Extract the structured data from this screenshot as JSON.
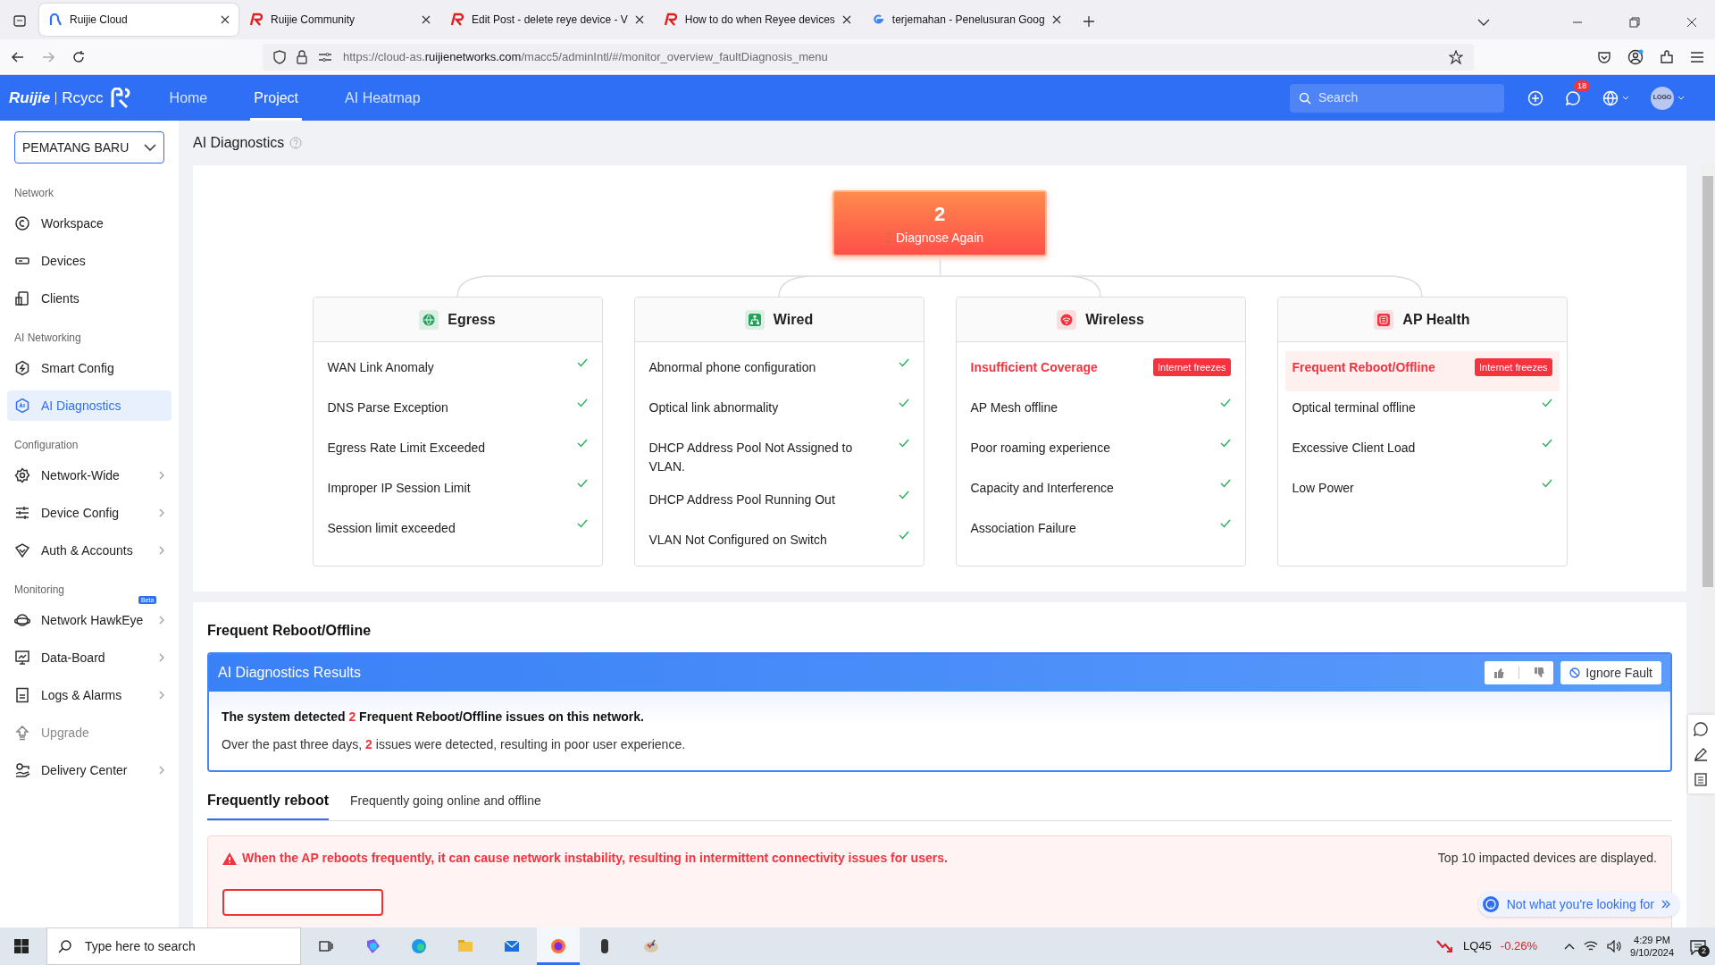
{
  "browser": {
    "tabs": [
      {
        "kind": "cloud",
        "title": "Ruijie Cloud",
        "selected": true
      },
      {
        "kind": "ruijie",
        "title": "Ruijie Community",
        "selected": false
      },
      {
        "kind": "ruijie",
        "title": "Edit Post - delete reye device - V",
        "selected": false
      },
      {
        "kind": "ruijie",
        "title": "How to do when Reyee devices",
        "selected": false
      },
      {
        "kind": "google",
        "title": "terjemahan - Penelusuran Goog",
        "selected": false
      }
    ],
    "url": {
      "prefix": "https://cloud-as.",
      "domain": "ruijienetworks.com",
      "path": "/macc5/adminIntl/#/monitor_overview_faultDiagnosis_menu"
    }
  },
  "header": {
    "logo": {
      "brand": "Ruijie",
      "product": "Rcycc"
    },
    "nav": [
      {
        "label": "Home",
        "selected": false
      },
      {
        "label": "Project",
        "selected": true
      },
      {
        "label": "AI Heatmap",
        "selected": false
      }
    ],
    "search": {
      "placeholder": "Search"
    },
    "notifications": "18",
    "avatar": "LOGO"
  },
  "sidebar": {
    "project": "PEMATANG BARU",
    "sections": [
      {
        "title": "Network",
        "items": [
          {
            "label": "Workspace",
            "selected": false,
            "expandable": false,
            "disabled": false
          },
          {
            "label": "Devices",
            "selected": false,
            "expandable": false,
            "disabled": false
          },
          {
            "label": "Clients",
            "selected": false,
            "expandable": false,
            "disabled": false
          }
        ]
      },
      {
        "title": "AI Networking",
        "items": [
          {
            "label": "Smart Config",
            "selected": false,
            "expandable": false,
            "disabled": false
          },
          {
            "label": "AI Diagnostics",
            "selected": true,
            "expandable": false,
            "disabled": false
          }
        ]
      },
      {
        "title": "Configuration",
        "items": [
          {
            "label": "Network-Wide",
            "selected": false,
            "expandable": true,
            "disabled": false
          },
          {
            "label": "Device Config",
            "selected": false,
            "expandable": true,
            "disabled": false
          },
          {
            "label": "Auth & Accounts",
            "selected": false,
            "expandable": true,
            "disabled": false
          }
        ]
      },
      {
        "title": "Monitoring",
        "items": [
          {
            "label": "Network HawkEye",
            "badge": "Beta",
            "selected": false,
            "expandable": true,
            "disabled": false
          },
          {
            "label": "Data-Board",
            "selected": false,
            "expandable": true,
            "disabled": false
          },
          {
            "label": "Logs & Alarms",
            "selected": false,
            "expandable": true,
            "disabled": false
          },
          {
            "label": "Upgrade",
            "selected": false,
            "expandable": false,
            "disabled": true
          },
          {
            "label": "Delivery Center",
            "selected": false,
            "expandable": true,
            "disabled": false
          }
        ]
      }
    ]
  },
  "page_title": "AI Diagnostics",
  "diagnosis": {
    "count": "2",
    "action": "Diagnose Again",
    "categories": [
      {
        "title": "Egress",
        "color": "#22a35a",
        "items": [
          {
            "kind": "ok",
            "label": "WAN Link Anomaly",
            "selected": false
          },
          {
            "kind": "ok",
            "label": "DNS Parse Exception",
            "selected": false
          },
          {
            "kind": "ok",
            "label": "Egress Rate Limit Exceeded",
            "selected": false
          },
          {
            "kind": "ok",
            "label": "Improper IP Session Limit",
            "selected": false
          },
          {
            "kind": "ok",
            "label": "Session limit exceeded",
            "selected": false
          }
        ]
      },
      {
        "title": "Wired",
        "color": "#22a35a",
        "items": [
          {
            "kind": "ok",
            "label": "Abnormal phone configuration",
            "selected": false
          },
          {
            "kind": "ok",
            "label": "Optical link abnormality",
            "selected": false
          },
          {
            "kind": "ok",
            "label": "DHCP Address Pool Not Assigned to VLAN.",
            "selected": false
          },
          {
            "kind": "ok",
            "label": "DHCP Address Pool Running Out",
            "selected": false
          },
          {
            "kind": "ok",
            "label": "VLAN Not Configured on Switch",
            "selected": false
          }
        ]
      },
      {
        "title": "Wireless",
        "color": "#f5333f",
        "items": [
          {
            "kind": "fault",
            "label": "Insufficient Coverage",
            "tag": "Internet freezes",
            "selected": false
          },
          {
            "kind": "ok",
            "label": "AP Mesh offline",
            "selected": false
          },
          {
            "kind": "ok",
            "label": "Poor roaming experience",
            "selected": false
          },
          {
            "kind": "ok",
            "label": "Capacity and Interference",
            "selected": false
          },
          {
            "kind": "ok",
            "label": "Association Failure",
            "selected": false
          }
        ]
      },
      {
        "title": "AP Health",
        "color": "#f5333f",
        "items": [
          {
            "kind": "fault",
            "label": "Frequent Reboot/Offline",
            "tag": "Internet freezes",
            "selected": true
          },
          {
            "kind": "ok",
            "label": "Optical terminal offline",
            "selected": false
          },
          {
            "kind": "ok",
            "label": "Excessive Client Load",
            "selected": false
          },
          {
            "kind": "ok",
            "label": "Low Power",
            "selected": false
          }
        ]
      }
    ]
  },
  "detail": {
    "title": "Frequent Reboot/Offline",
    "results_title": "AI Diagnostics Results",
    "ignore_button": "Ignore Fault",
    "summary": {
      "before": "The system detected ",
      "count": "2",
      "after": " Frequent Reboot/Offline issues on this network."
    },
    "description": {
      "before": "Over the past three days, ",
      "count": "2",
      "after": " issues were detected, resulting in poor user experience."
    },
    "tabs": [
      {
        "label": "Frequently reboot",
        "selected": true
      },
      {
        "label": "Frequently going online and offline",
        "selected": false
      }
    ],
    "warning": "When the AP reboots frequently, it can cause network instability, resulting in intermittent connectivity issues for users.",
    "note": "Top 10 impacted devices are displayed."
  },
  "help_bubble": "Not what you're looking for",
  "taskbar": {
    "search": {
      "placeholder": "Type here to search"
    },
    "apps": [
      {
        "selected": false
      },
      {
        "selected": false
      },
      {
        "selected": false
      },
      {
        "selected": false
      },
      {
        "selected": true
      },
      {
        "selected": false
      },
      {
        "selected": false
      }
    ],
    "stock": {
      "symbol": "LQ45",
      "change": "-0.26%"
    },
    "time": "4:29 PM",
    "date": "9/10/2024",
    "notifications": "2"
  }
}
